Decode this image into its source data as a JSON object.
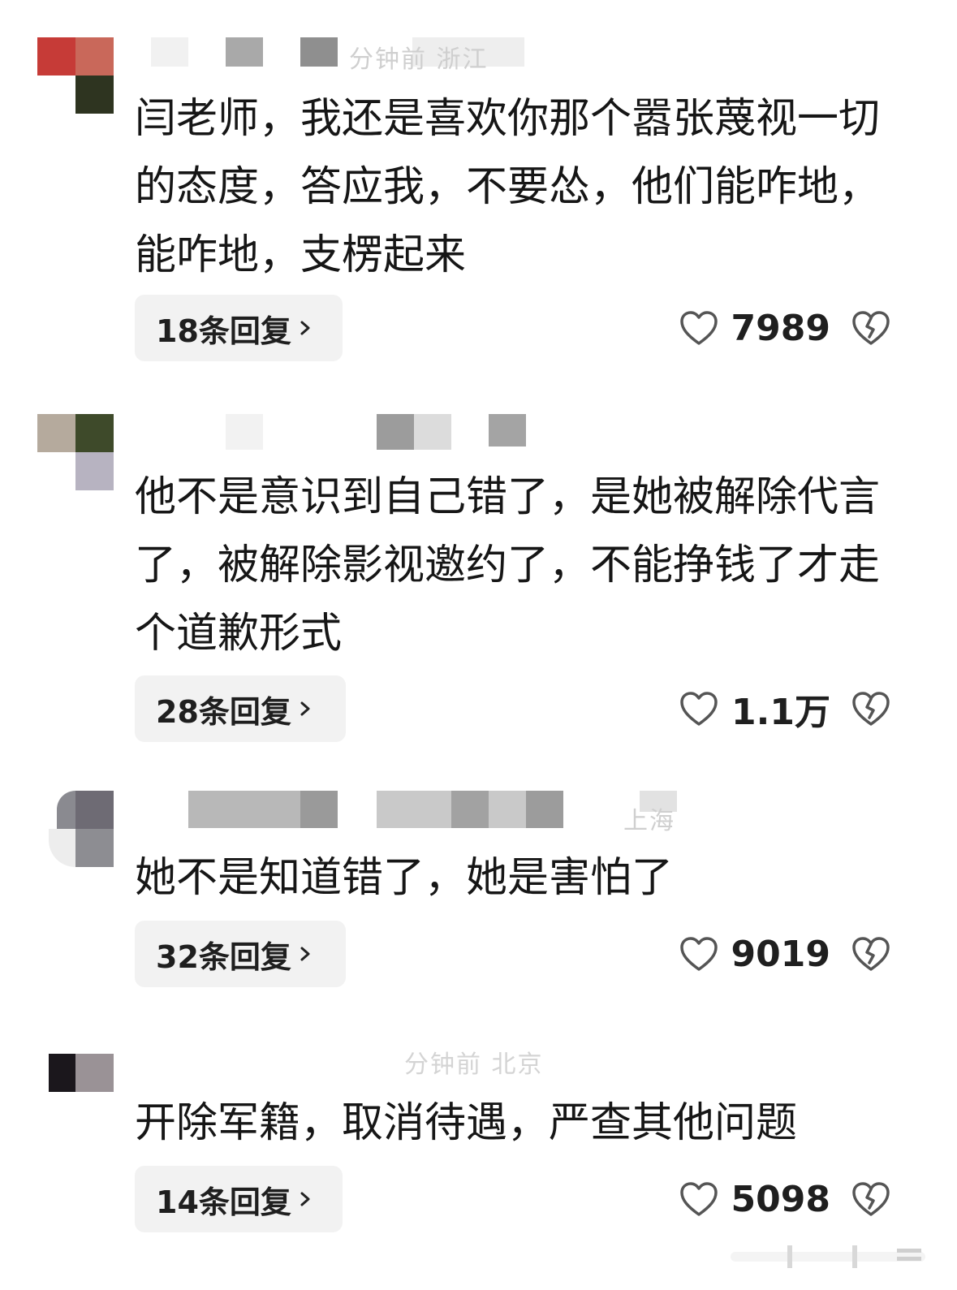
{
  "comments": [
    {
      "meta_text": "分钟前 浙江",
      "text": "闫老师，我还是喜欢你那个嚣张蔑视一切的态度，答应我，不要怂，他们能咋地，能咋地，支楞起来",
      "reply_label": "18条回复",
      "likes": "7989"
    },
    {
      "meta_text": "",
      "text": "他不是意识到自己错了，是她被解除代言了，被解除影视邀约了，不能挣钱了才走个道歉形式",
      "reply_label": "28条回复",
      "likes": "1.1万"
    },
    {
      "meta_text": "上海",
      "text": "她不是知道错了，她是害怕了",
      "reply_label": "32条回复",
      "likes": "9019"
    },
    {
      "meta_text": "分钟前 北京",
      "text": "开除军籍，取消待遇，严查其他问题",
      "reply_label": "14条回复",
      "likes": "5098"
    }
  ],
  "icons": {
    "like": "heart-outline-icon",
    "dislike": "broken-heart-icon",
    "chevron": "chevron-right-icon"
  },
  "colors": {
    "text": "#161616",
    "reply_bg": "#f2f2f2",
    "icon": "#555555"
  }
}
